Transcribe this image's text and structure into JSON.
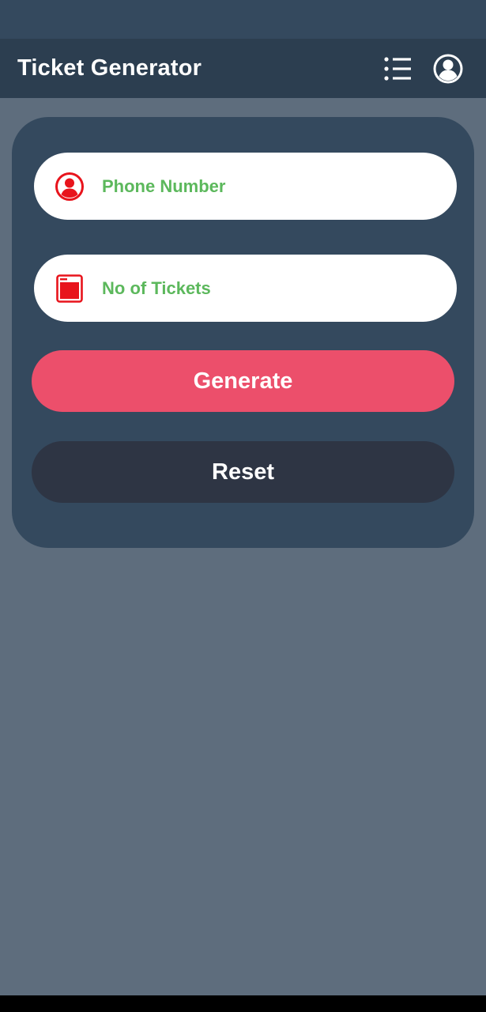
{
  "app": {
    "title": "Ticket Generator"
  },
  "header": {
    "menu_icon": "list-menu-icon",
    "account_icon": "account-circle-icon"
  },
  "form": {
    "phone": {
      "placeholder": "Phone Number",
      "value": "",
      "icon": "person-icon"
    },
    "tickets": {
      "placeholder": "No of Tickets",
      "value": "",
      "icon": "ticket-icon"
    },
    "generate_label": "Generate",
    "reset_label": "Reset"
  },
  "colors": {
    "status_bar": "#34495e",
    "app_bar": "#2c3e50",
    "background": "#5e6d7d",
    "card": "#34495e",
    "placeholder_text": "#5cb85c",
    "icon_red": "#e8141c",
    "generate_button": "#ec4f6b",
    "reset_button": "#2e3544"
  }
}
